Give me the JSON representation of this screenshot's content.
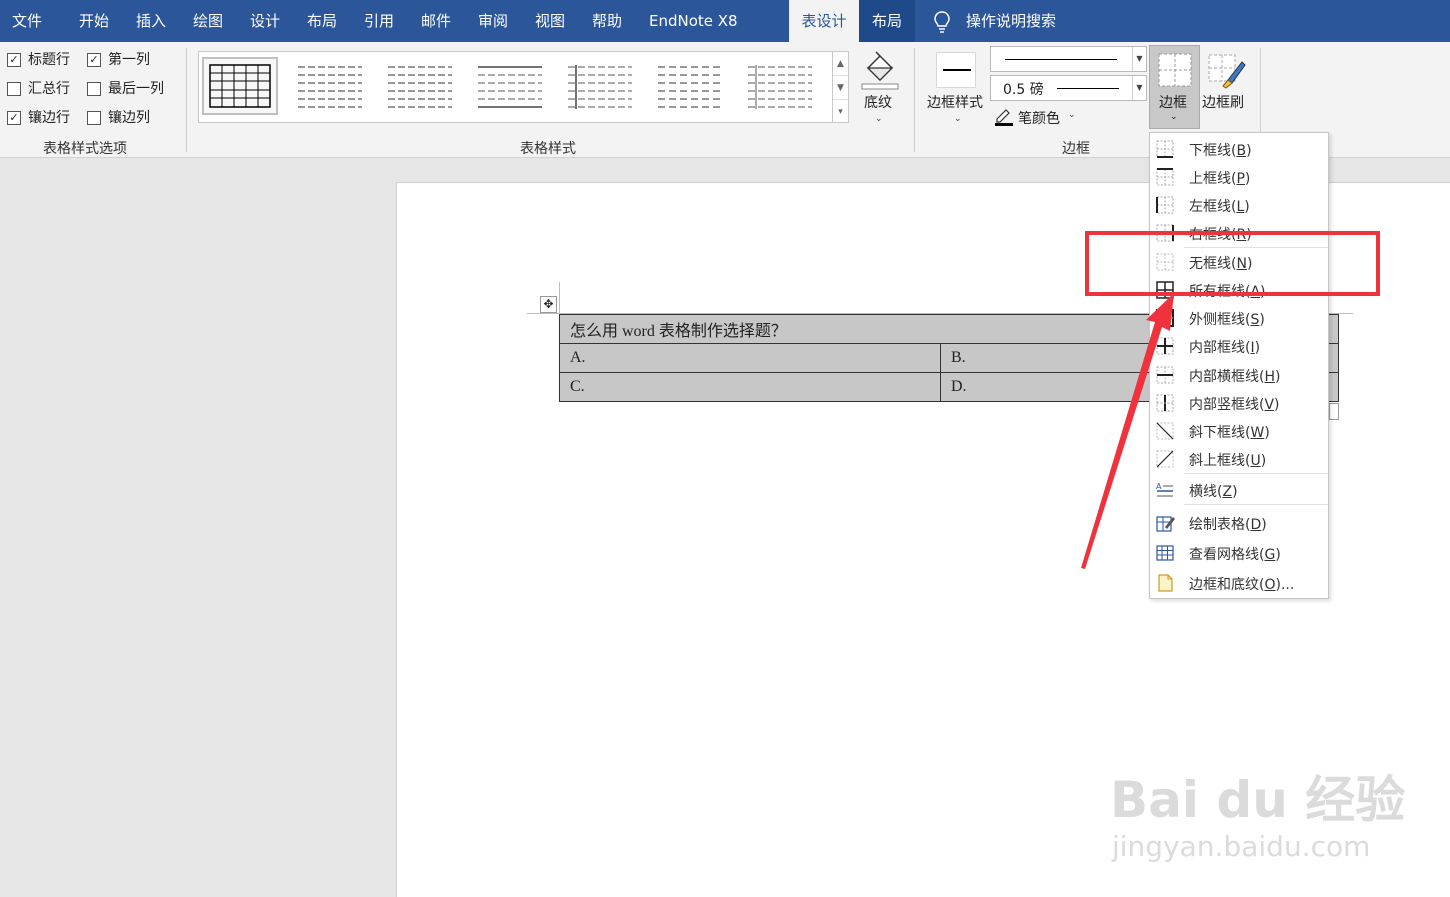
{
  "tabs": [
    {
      "id": "file",
      "label": "文件"
    },
    {
      "id": "home",
      "label": "开始"
    },
    {
      "id": "insert",
      "label": "插入"
    },
    {
      "id": "draw",
      "label": "绘图"
    },
    {
      "id": "design",
      "label": "设计"
    },
    {
      "id": "layout",
      "label": "布局"
    },
    {
      "id": "references",
      "label": "引用"
    },
    {
      "id": "mailings",
      "label": "邮件"
    },
    {
      "id": "review",
      "label": "审阅"
    },
    {
      "id": "view",
      "label": "视图"
    },
    {
      "id": "help",
      "label": "帮助"
    },
    {
      "id": "endnote",
      "label": "EndNote X8"
    },
    {
      "id": "table-design",
      "label": "表设计"
    },
    {
      "id": "table-layout",
      "label": "布局"
    }
  ],
  "search": {
    "label": "操作说明搜索"
  },
  "style_options": {
    "header_row": {
      "label": "标题行",
      "checked": true
    },
    "first_column": {
      "label": "第一列",
      "checked": true
    },
    "total_row": {
      "label": "汇总行",
      "checked": false
    },
    "last_column": {
      "label": "最后一列",
      "checked": false
    },
    "banded_rows": {
      "label": "镶边行",
      "checked": true
    },
    "banded_columns": {
      "label": "镶边列",
      "checked": false
    },
    "group_label": "表格样式选项"
  },
  "table_styles": {
    "group_label": "表格样式"
  },
  "shading": {
    "label": "底纹"
  },
  "borders_group": {
    "border_styles_label": "边框样式",
    "weight": "0.5 磅",
    "pen_color_label": "笔颜色",
    "borders_label": "边框",
    "border_painter_label": "边框刷",
    "group_label": "边框"
  },
  "document": {
    "table": {
      "title": "怎么用 word 表格制作选择题？",
      "a": "A.",
      "b": "B.",
      "c": "C.",
      "d": "D."
    }
  },
  "borders_menu": {
    "items": [
      {
        "text": "下框线(",
        "key": "B",
        "end": ")"
      },
      {
        "text": "上框线(",
        "key": "P",
        "end": ")"
      },
      {
        "text": "左框线(",
        "key": "L",
        "end": ")"
      },
      {
        "text": "右框线(",
        "key": "R",
        "end": ")"
      },
      {
        "text": "无框线(",
        "key": "N",
        "end": ")"
      },
      {
        "text": "所有框线(",
        "key": "A",
        "end": ")"
      },
      {
        "text": "外侧框线(",
        "key": "S",
        "end": ")"
      },
      {
        "text": "内部框线(",
        "key": "I",
        "end": ")"
      },
      {
        "text": "内部横框线(",
        "key": "H",
        "end": ")"
      },
      {
        "text": "内部竖框线(",
        "key": "V",
        "end": ")"
      },
      {
        "text": "斜下框线(",
        "key": "W",
        "end": ")"
      },
      {
        "text": "斜上框线(",
        "key": "U",
        "end": ")"
      },
      {
        "text": "横线(",
        "key": "Z",
        "end": ")"
      },
      {
        "text": "绘制表格(",
        "key": "D",
        "end": ")"
      },
      {
        "text": "查看网格线(",
        "key": "G",
        "end": ")"
      },
      {
        "text": "边框和底纹(",
        "key": "O",
        "end": ")..."
      }
    ]
  },
  "watermark": {
    "brand": "Bai du 经验",
    "url": "jingyan.baidu.com"
  },
  "colors": {
    "ribbon_blue": "#2b579a",
    "highlight_red": "#f0323c"
  }
}
